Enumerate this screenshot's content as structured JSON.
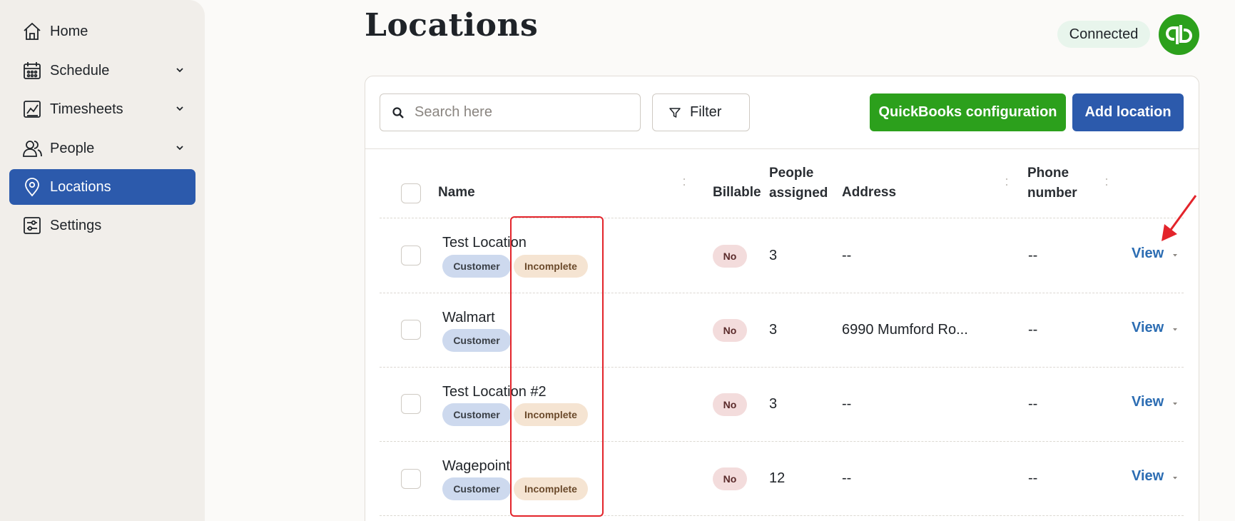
{
  "sidebar": {
    "items": [
      {
        "label": "Home",
        "icon": "home-icon",
        "has_chevron": false,
        "active": false
      },
      {
        "label": "Schedule",
        "icon": "calendar-icon",
        "has_chevron": true,
        "active": false
      },
      {
        "label": "Timesheets",
        "icon": "chart-line-icon",
        "has_chevron": true,
        "active": false
      },
      {
        "label": "People",
        "icon": "people-icon",
        "has_chevron": true,
        "active": false
      },
      {
        "label": "Locations",
        "icon": "location-pin-icon",
        "has_chevron": false,
        "active": true
      },
      {
        "label": "Settings",
        "icon": "sliders-icon",
        "has_chevron": false,
        "active": false
      }
    ]
  },
  "header": {
    "title": "Locations",
    "connection_status": "Connected"
  },
  "toolbar": {
    "search_placeholder": "Search here",
    "filter_label": "Filter",
    "qb_config_label": "QuickBooks configuration",
    "add_label": "Add location"
  },
  "table": {
    "columns": {
      "name": "Name",
      "billable": "Billable",
      "people_line1": "People",
      "people_line2": "assigned",
      "address": "Address",
      "phone_line1": "Phone",
      "phone_line2": "number"
    },
    "rows": [
      {
        "name": "Test Location",
        "tags": [
          "Customer",
          "Incomplete"
        ],
        "billable": "No",
        "people": "3",
        "address": "--",
        "phone": "--",
        "action": "View"
      },
      {
        "name": "Walmart",
        "tags": [
          "Customer"
        ],
        "billable": "No",
        "people": "3",
        "address": "6990 Mumford Ro...",
        "phone": "--",
        "action": "View"
      },
      {
        "name": "Test Location #2",
        "tags": [
          "Customer",
          "Incomplete"
        ],
        "billable": "No",
        "people": "3",
        "address": "--",
        "phone": "--",
        "action": "View"
      },
      {
        "name": "Wagepoint",
        "tags": [
          "Customer",
          "Incomplete"
        ],
        "billable": "No",
        "people": "12",
        "address": "--",
        "phone": "--",
        "action": "View"
      }
    ]
  },
  "colors": {
    "primary_blue": "#2c5aac",
    "quickbooks_green": "#2ca01c",
    "annotation_red": "#e3242b"
  }
}
